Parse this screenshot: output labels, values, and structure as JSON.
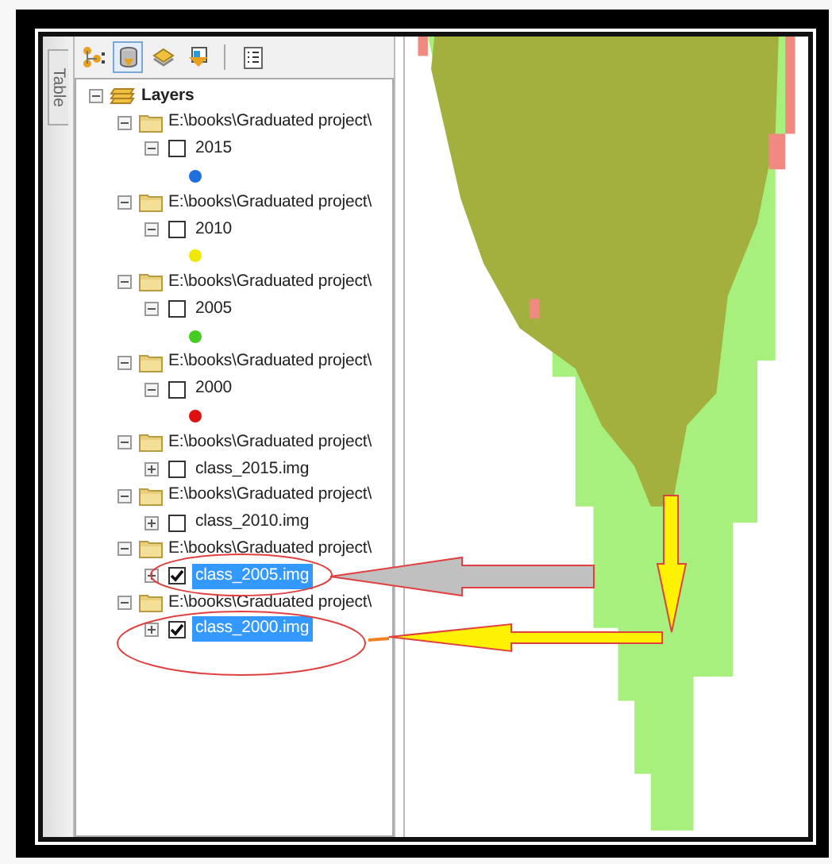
{
  "side_tab": {
    "label": "Table"
  },
  "toolbar": [
    {
      "kind": "nodes",
      "selected": false
    },
    {
      "kind": "cylinder",
      "selected": true
    },
    {
      "kind": "stack",
      "selected": false
    },
    {
      "kind": "document",
      "selected": false
    },
    {
      "kind": "options",
      "selected": false
    }
  ],
  "toc": {
    "root": {
      "label": "Layers",
      "expanded": true
    },
    "groups": [
      {
        "path": "E:\\books\\Graduated project\\",
        "expanded": true,
        "layer": {
          "name": "2015",
          "checked": false,
          "selected": false,
          "expanded": true,
          "color": "#1f6fe0"
        }
      },
      {
        "path": "E:\\books\\Graduated project\\",
        "expanded": true,
        "layer": {
          "name": "2010",
          "checked": false,
          "selected": false,
          "expanded": true,
          "color": "#f0e800"
        }
      },
      {
        "path": "E:\\books\\Graduated project\\",
        "expanded": true,
        "layer": {
          "name": "2005",
          "checked": false,
          "selected": false,
          "expanded": true,
          "color": "#44cc22"
        }
      },
      {
        "path": "E:\\books\\Graduated project\\",
        "expanded": true,
        "layer": {
          "name": "2000",
          "checked": false,
          "selected": false,
          "expanded": true,
          "color": "#dd1111"
        }
      },
      {
        "path": "E:\\books\\Graduated project\\",
        "expanded": true,
        "layer": {
          "name": "class_2015.img",
          "checked": false,
          "selected": false,
          "expanded": false
        }
      },
      {
        "path": "E:\\books\\Graduated project\\",
        "expanded": true,
        "layer": {
          "name": "class_2010.img",
          "checked": false,
          "selected": false,
          "expanded": false
        }
      },
      {
        "path": "E:\\books\\Graduated project\\",
        "expanded": true,
        "layer": {
          "name": "class_2005.img",
          "checked": true,
          "selected": true,
          "expanded": false
        }
      },
      {
        "path": "E:\\books\\Graduated project\\",
        "expanded": true,
        "layer": {
          "name": "class_2000.img",
          "checked": true,
          "selected": true,
          "expanded": false
        }
      }
    ]
  }
}
